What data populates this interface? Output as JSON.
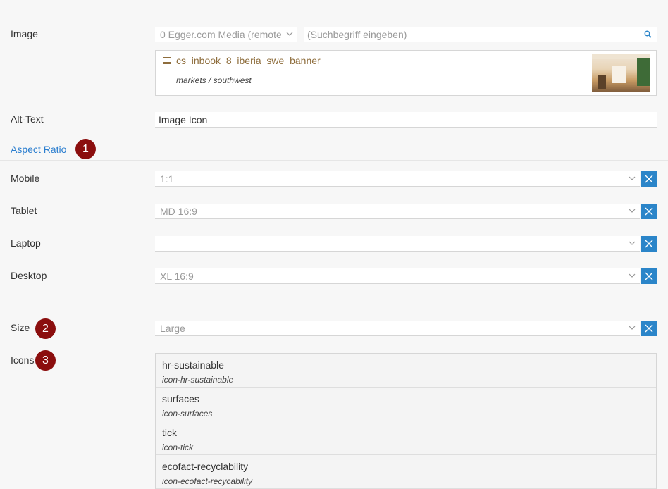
{
  "image": {
    "label": "Image",
    "source_select": "0 Egger.com Media (remote",
    "search_placeholder": "(Suchbegriff eingeben)",
    "selected": {
      "title": "cs_inbook_8_iberia_swe_banner",
      "path": "markets / southwest"
    }
  },
  "alt_text": {
    "label": "Alt-Text",
    "value": "Image Icon"
  },
  "aspect_ratio": {
    "label": "Aspect Ratio",
    "badge": "1",
    "fields": [
      {
        "label": "Mobile",
        "value": "1:1"
      },
      {
        "label": "Tablet",
        "value": "MD 16:9"
      },
      {
        "label": "Laptop",
        "value": ""
      },
      {
        "label": "Desktop",
        "value": "XL 16:9"
      }
    ]
  },
  "size": {
    "label": "Size",
    "badge": "2",
    "value": "Large"
  },
  "icons": {
    "label": "Icons",
    "badge": "3",
    "items": [
      {
        "name": "hr-sustainable",
        "code": "icon-hr-sustainable"
      },
      {
        "name": "surfaces",
        "code": "icon-surfaces"
      },
      {
        "name": "tick",
        "code": "icon-tick"
      },
      {
        "name": "ecofact-recyclability",
        "code": "icon-ecofact-recycability"
      }
    ]
  },
  "colors": {
    "accent": "#2b85c9",
    "badge": "#8b0e0e",
    "link": "#2b7ecf",
    "media_title": "#8e6d3c"
  }
}
